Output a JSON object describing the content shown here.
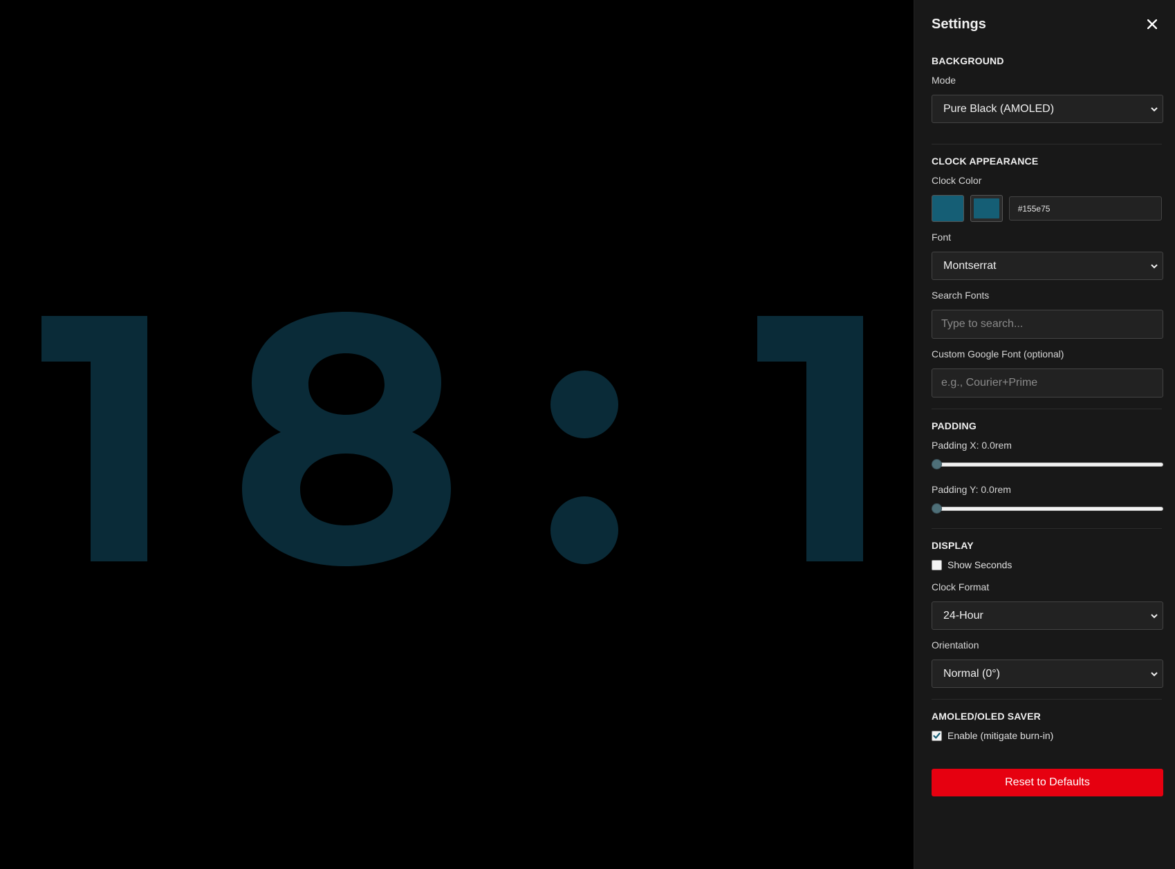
{
  "clock": {
    "time_text": "18:1",
    "color": "#0a2b38"
  },
  "panel": {
    "title": "Settings",
    "close_icon": "close-icon"
  },
  "background": {
    "section_title": "BACKGROUND",
    "mode_label": "Mode",
    "mode_value": "Pure Black (AMOLED)"
  },
  "appearance": {
    "section_title": "CLOCK APPEARANCE",
    "color_label": "Clock Color",
    "color_hex": "#155e75",
    "font_label": "Font",
    "font_value": "Montserrat",
    "search_label": "Search Fonts",
    "search_placeholder": "Type to search...",
    "custom_font_label": "Custom Google Font (optional)",
    "custom_font_placeholder": "e.g., Courier+Prime"
  },
  "padding": {
    "section_title": "PADDING",
    "x_label": "Padding X: 0.0rem",
    "x_value": 0.0,
    "y_label": "Padding Y: 0.0rem",
    "y_value": 0.0
  },
  "display": {
    "section_title": "DISPLAY",
    "show_seconds_label": "Show Seconds",
    "show_seconds_checked": false,
    "format_label": "Clock Format",
    "format_value": "24-Hour",
    "orientation_label": "Orientation",
    "orientation_value": "Normal (0°)"
  },
  "saver": {
    "section_title": "AMOLED/OLED SAVER",
    "enable_label": "Enable (mitigate burn-in)",
    "enable_checked": true
  },
  "reset_label": "Reset to Defaults",
  "colors": {
    "panel_bg": "#181818",
    "accent_red": "#e60010",
    "clock_color": "#155e75"
  }
}
